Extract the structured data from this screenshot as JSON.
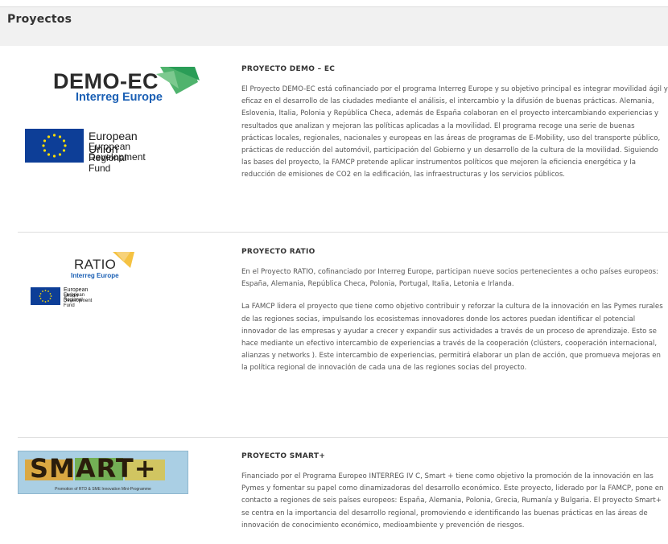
{
  "page": {
    "title": "Proyectos"
  },
  "projects": [
    {
      "title": "PROYECTO DEMO – EC",
      "logo": {
        "word": "DEMO-EC",
        "sub": "Interreg Europe",
        "eu_lines": [
          "European Union",
          "European Regional",
          "Development Fund"
        ]
      },
      "paragraphs": [
        "El Proyecto DEMO-EC está cofinanciado por el programa Interreg Europe y su objetivo principal es integrar movilidad ágil y eficaz en el desarrollo de las ciudades mediante el análisis, el intercambio y la difusión de buenas prácticas. Alemania, Eslovenia, Italia, Polonia y República Checa, además de España colaboran en el proyecto intercambiando experiencias y resultados que analizan y mejoran las políticas aplicadas a la movilidad. El programa recoge una serie de buenas prácticas locales, regionales, nacionales y europeas en las áreas de programas de E-Mobility, uso del transporte público, prácticas de reducción del automóvil, participación del Gobierno y un desarrollo de la cultura de la movilidad. Siguiendo las bases del proyecto, la FAMCP pretende aplicar instrumentos políticos que mejoren la eficiencia energética y la reducción de emisiones de CO2 en la edificación, las infraestructuras y los servicios públicos."
      ]
    },
    {
      "title": "PROYECTO RATIO",
      "logo": {
        "word": "RATIO",
        "sub": "Interreg Europe",
        "eu_lines": [
          "European Union",
          "European Regional",
          "Development Fund"
        ]
      },
      "paragraphs": [
        "En el Proyecto RATIO, cofinanciado por Interreg Europe, participan nueve socios pertenecientes a ocho países europeos: España, Alemania, República Checa, Polonia, Portugal, Italia, Letonia e Irlanda.",
        "La FAMCP lidera el proyecto que tiene como objetivo contribuir y reforzar la cultura de la innovación en las Pymes rurales de las regiones socias, impulsando los ecosistemas innovadores donde los actores puedan identificar el potencial innovador de las empresas y ayudar a crecer y expandir sus actividades a través de un proceso de aprendizaje. Esto se hace mediante un efectivo intercambio de experiencias a través de la cooperación (clústers, cooperación internacional, alianzas y networks ). Este intercambio de experiencias, permitirá elaborar un plan de acción, que promueva mejoras en la política regional de innovación de cada una de las regiones socias del proyecto."
      ]
    },
    {
      "title": "PROYECTO SMART+",
      "logo": {
        "word": "SMART+",
        "caption": "Promotion of RTD & SME Innovation Mini-Programme"
      },
      "paragraphs": [
        "Financiado por el Programa Europeo INTERREG IV C, Smart + tiene como objetivo la promoción de la innovación en las Pymes y fomentar su papel como dinamizadoras del desarrollo económico. Este proyecto, liderado por la FAMCP, pone en contacto a regiones de seis países europeos: España, Alemania, Polonia, Grecia, Rumanía y Bulgaria.  El proyecto Smart+ se centra en la importancia del desarrollo regional, promoviendo e identificando las buenas prácticas en las áreas de innovación de conocimiento económico, medioambiente y prevención de riesgos."
      ]
    }
  ],
  "colors": {
    "header_bg": "#f1f1f1",
    "interreg_blue": "#1a5fb4",
    "eu_blue": "#0d3e97",
    "eu_star": "#ffdd00",
    "demo_green": "#2a9d57",
    "ratio_yellow": "#f5c242"
  },
  "icons": {
    "demo": "demo-ec-logo",
    "ratio": "ratio-logo",
    "smart": "smart-plus-logo",
    "eu": "eu-flag-icon"
  }
}
